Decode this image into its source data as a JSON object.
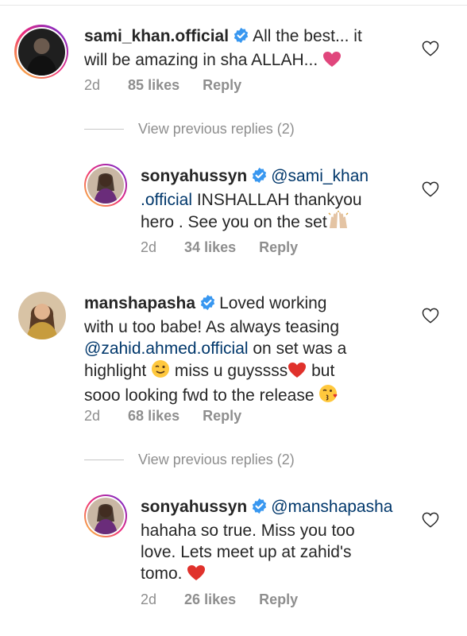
{
  "comments": [
    {
      "username": "sami_khan.official",
      "text_parts": [
        "All the best... it",
        "will be amazing in sha ALLAH... "
      ],
      "age": "2d",
      "likes": "85 likes",
      "reply": "Reply"
    },
    {
      "username": "sonyahussyn",
      "mention_a": "@sami_khan",
      "mention_b": ".official",
      "text_a": " INSHALLAH thankyou",
      "text_b": "hero . See you on the set",
      "age": "2d",
      "likes": "34 likes",
      "reply": "Reply"
    },
    {
      "username": "manshapasha",
      "line1": "Loved working",
      "line2": "with u too babe! As always teasing",
      "mention": "@zahid.ahmed.official",
      "line3_rest": " on set was a",
      "line4_a": "highlight ",
      "line4_b": " miss u guyssss",
      "line4_c": " but",
      "line5": "sooo looking fwd to the release ",
      "age": "2d",
      "likes": "68 likes",
      "reply": "Reply"
    },
    {
      "username": "sonyahussyn",
      "mention": "@manshapasha",
      "line2": "hahaha so true. Miss you too",
      "line3": "love. Lets meet up at zahid's",
      "line4": "tomo. ",
      "age": "2d",
      "likes": "26 likes",
      "reply": "Reply"
    }
  ],
  "view_previous_1": "View previous replies (2)",
  "view_previous_2": "View previous replies (2)",
  "colors": {
    "text": "#262626",
    "muted": "#8e8e8e",
    "link": "#00376b",
    "verified": "#3897f0",
    "heart": "#ed4956"
  },
  "icons": {
    "verified": "verified-badge-icon",
    "like": "heart-outline-icon"
  }
}
